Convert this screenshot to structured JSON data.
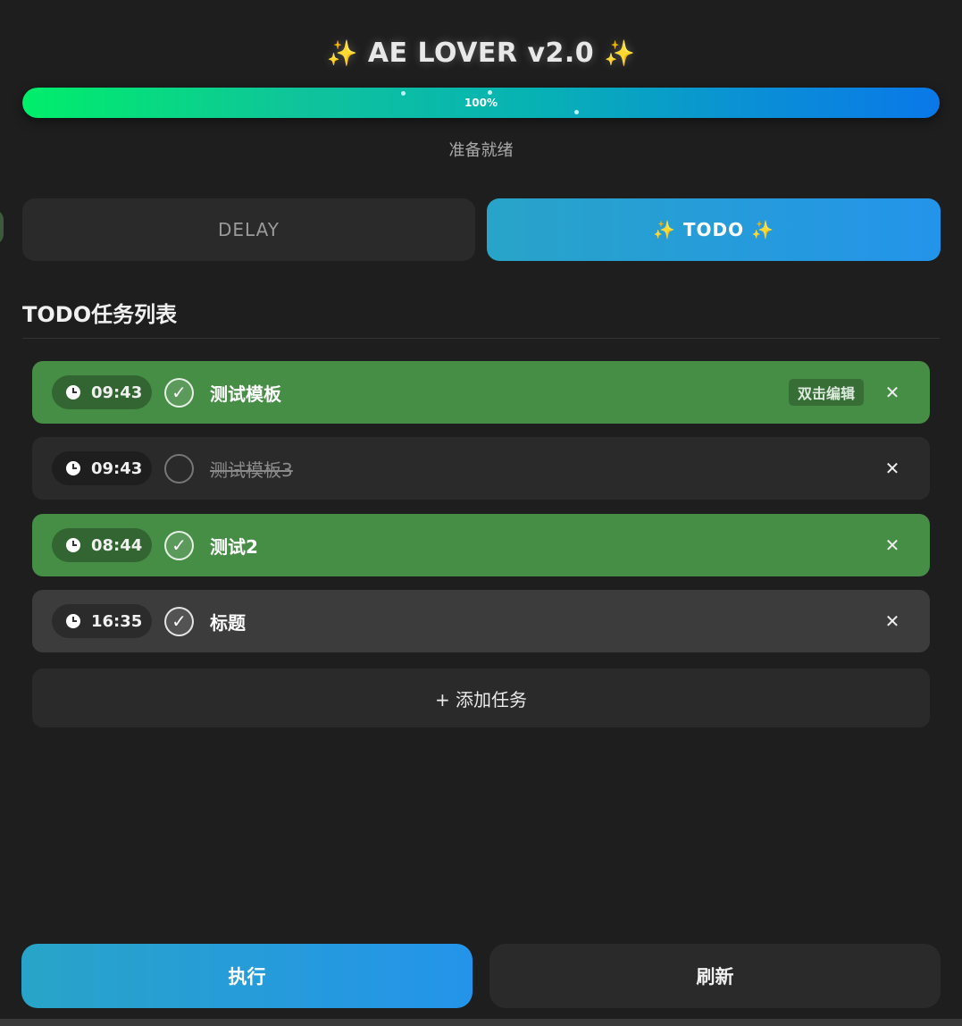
{
  "header": {
    "spark": "✨",
    "title": "AE LOVER v2.0",
    "progress_value": 100,
    "progress_text": "100%",
    "status": "准备就绪"
  },
  "tabs": [
    {
      "label": "DELAY",
      "active": false
    },
    {
      "label": "TODO",
      "active": true
    }
  ],
  "section": {
    "title": "TODO任务列表"
  },
  "tasks": [
    {
      "time": "09:43",
      "checked": true,
      "title": "测试模板",
      "hint": "双击编辑"
    },
    {
      "time": "09:43",
      "checked": false,
      "title": "测试模板3"
    },
    {
      "time": "08:44",
      "checked": true,
      "title": "测试2"
    },
    {
      "time": "16:35",
      "checked": true,
      "title": "标题"
    }
  ],
  "icons": {
    "check": "✓",
    "close": "✕"
  },
  "add_task": "+ 添加任务",
  "buttons": {
    "run": "执行",
    "refresh": "刷新"
  },
  "colors": {
    "accent_start": "#28a4c8",
    "accent_end": "#2494ea",
    "task_done": "#468d45",
    "background": "#1e1e1e"
  }
}
